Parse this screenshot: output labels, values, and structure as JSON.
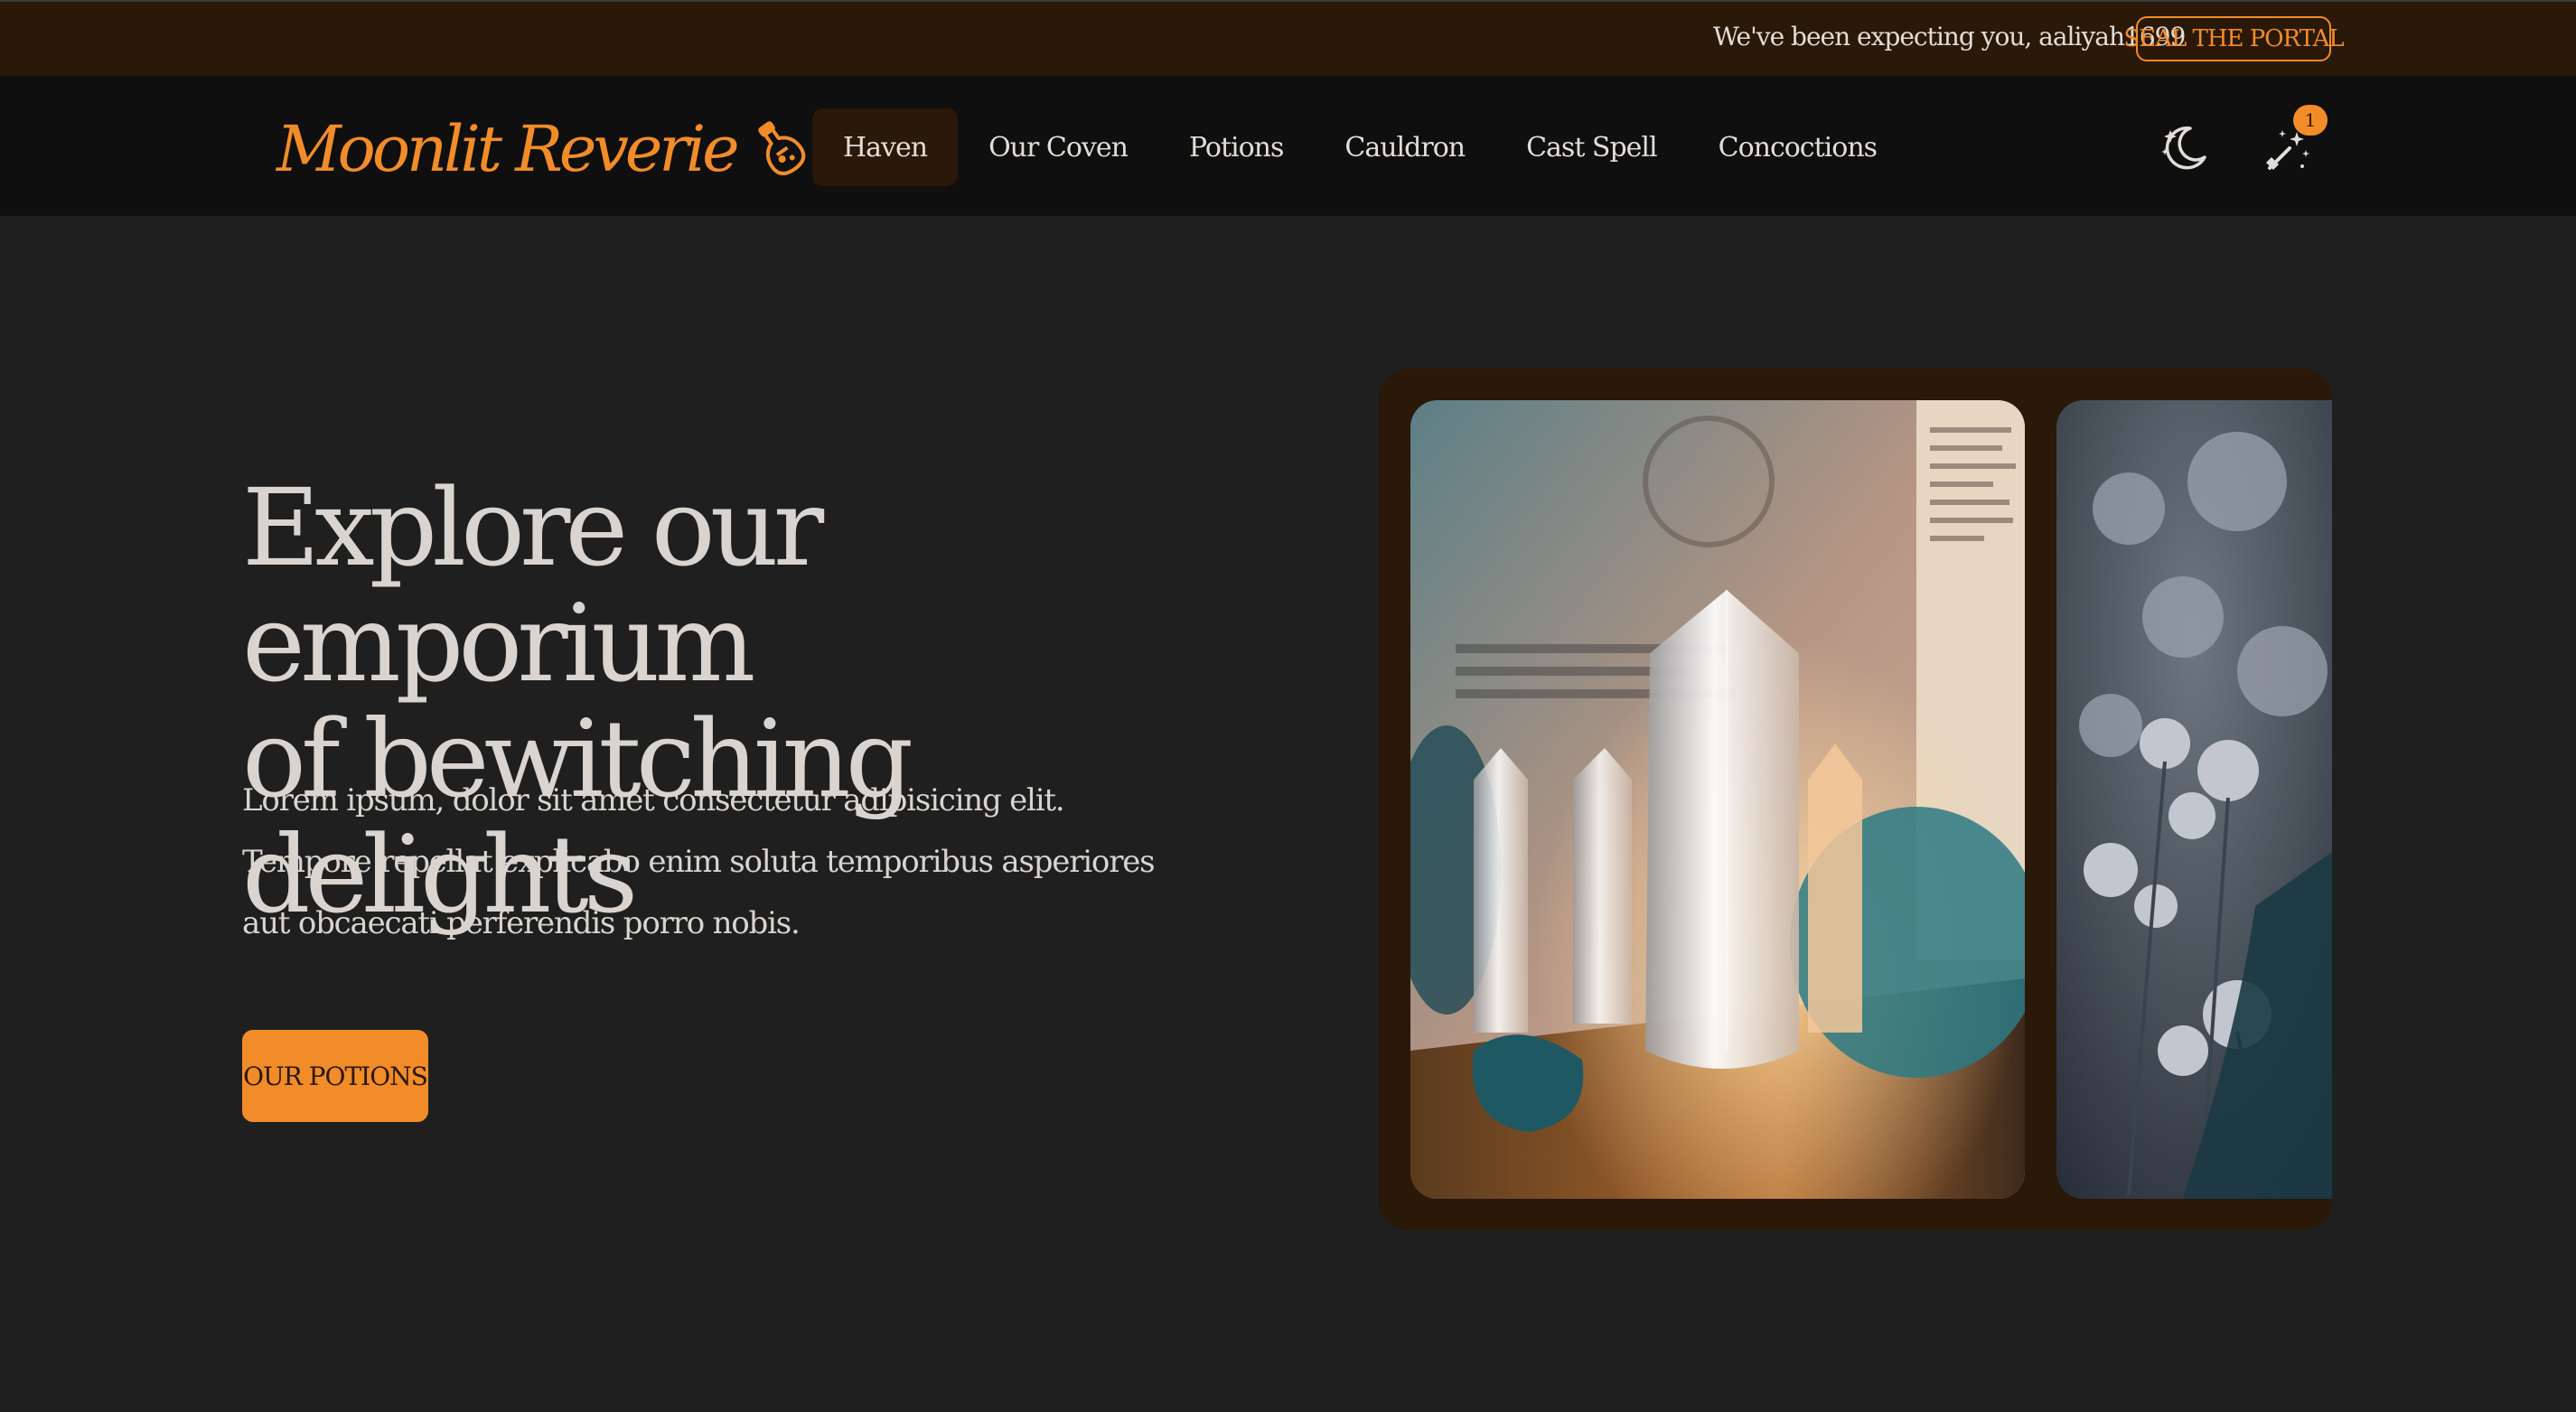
{
  "topbar": {
    "welcome_text": "We've been expecting you, aaliyah1699",
    "seal_button": "SEAL THE PORTAL"
  },
  "brand": {
    "name": "Moonlit Reverie",
    "icon": "potion-bottle-icon",
    "accent_color": "#f28c28"
  },
  "nav": {
    "items": [
      {
        "label": "Haven",
        "active": true
      },
      {
        "label": "Our Coven"
      },
      {
        "label": "Potions"
      },
      {
        "label": "Cauldron"
      },
      {
        "label": "Cast Spell"
      },
      {
        "label": "Concoctions"
      }
    ],
    "theme_icon": "moon-stars-icon",
    "cart_icon": "magic-wand-icon",
    "cart_count": "1"
  },
  "hero": {
    "title_line1": "Explore our emporium",
    "title_line2": "of bewitching delights",
    "description": "Lorem ipsum, dolor sit amet consectetur adipisicing elit. Tempore repellat explicabo enim soluta temporibus asperiores aut obcaecati perferendis porro nobis.",
    "cta_label": "OUR POTIONS"
  },
  "gallery": {
    "images": [
      "crystals-photo",
      "dried-flowers-photo"
    ]
  },
  "colors": {
    "topbar_bg": "#2a1808",
    "navbar_bg": "#0f0f0f",
    "page_bg": "#1f1f1f",
    "text": "#d9d4cf"
  }
}
